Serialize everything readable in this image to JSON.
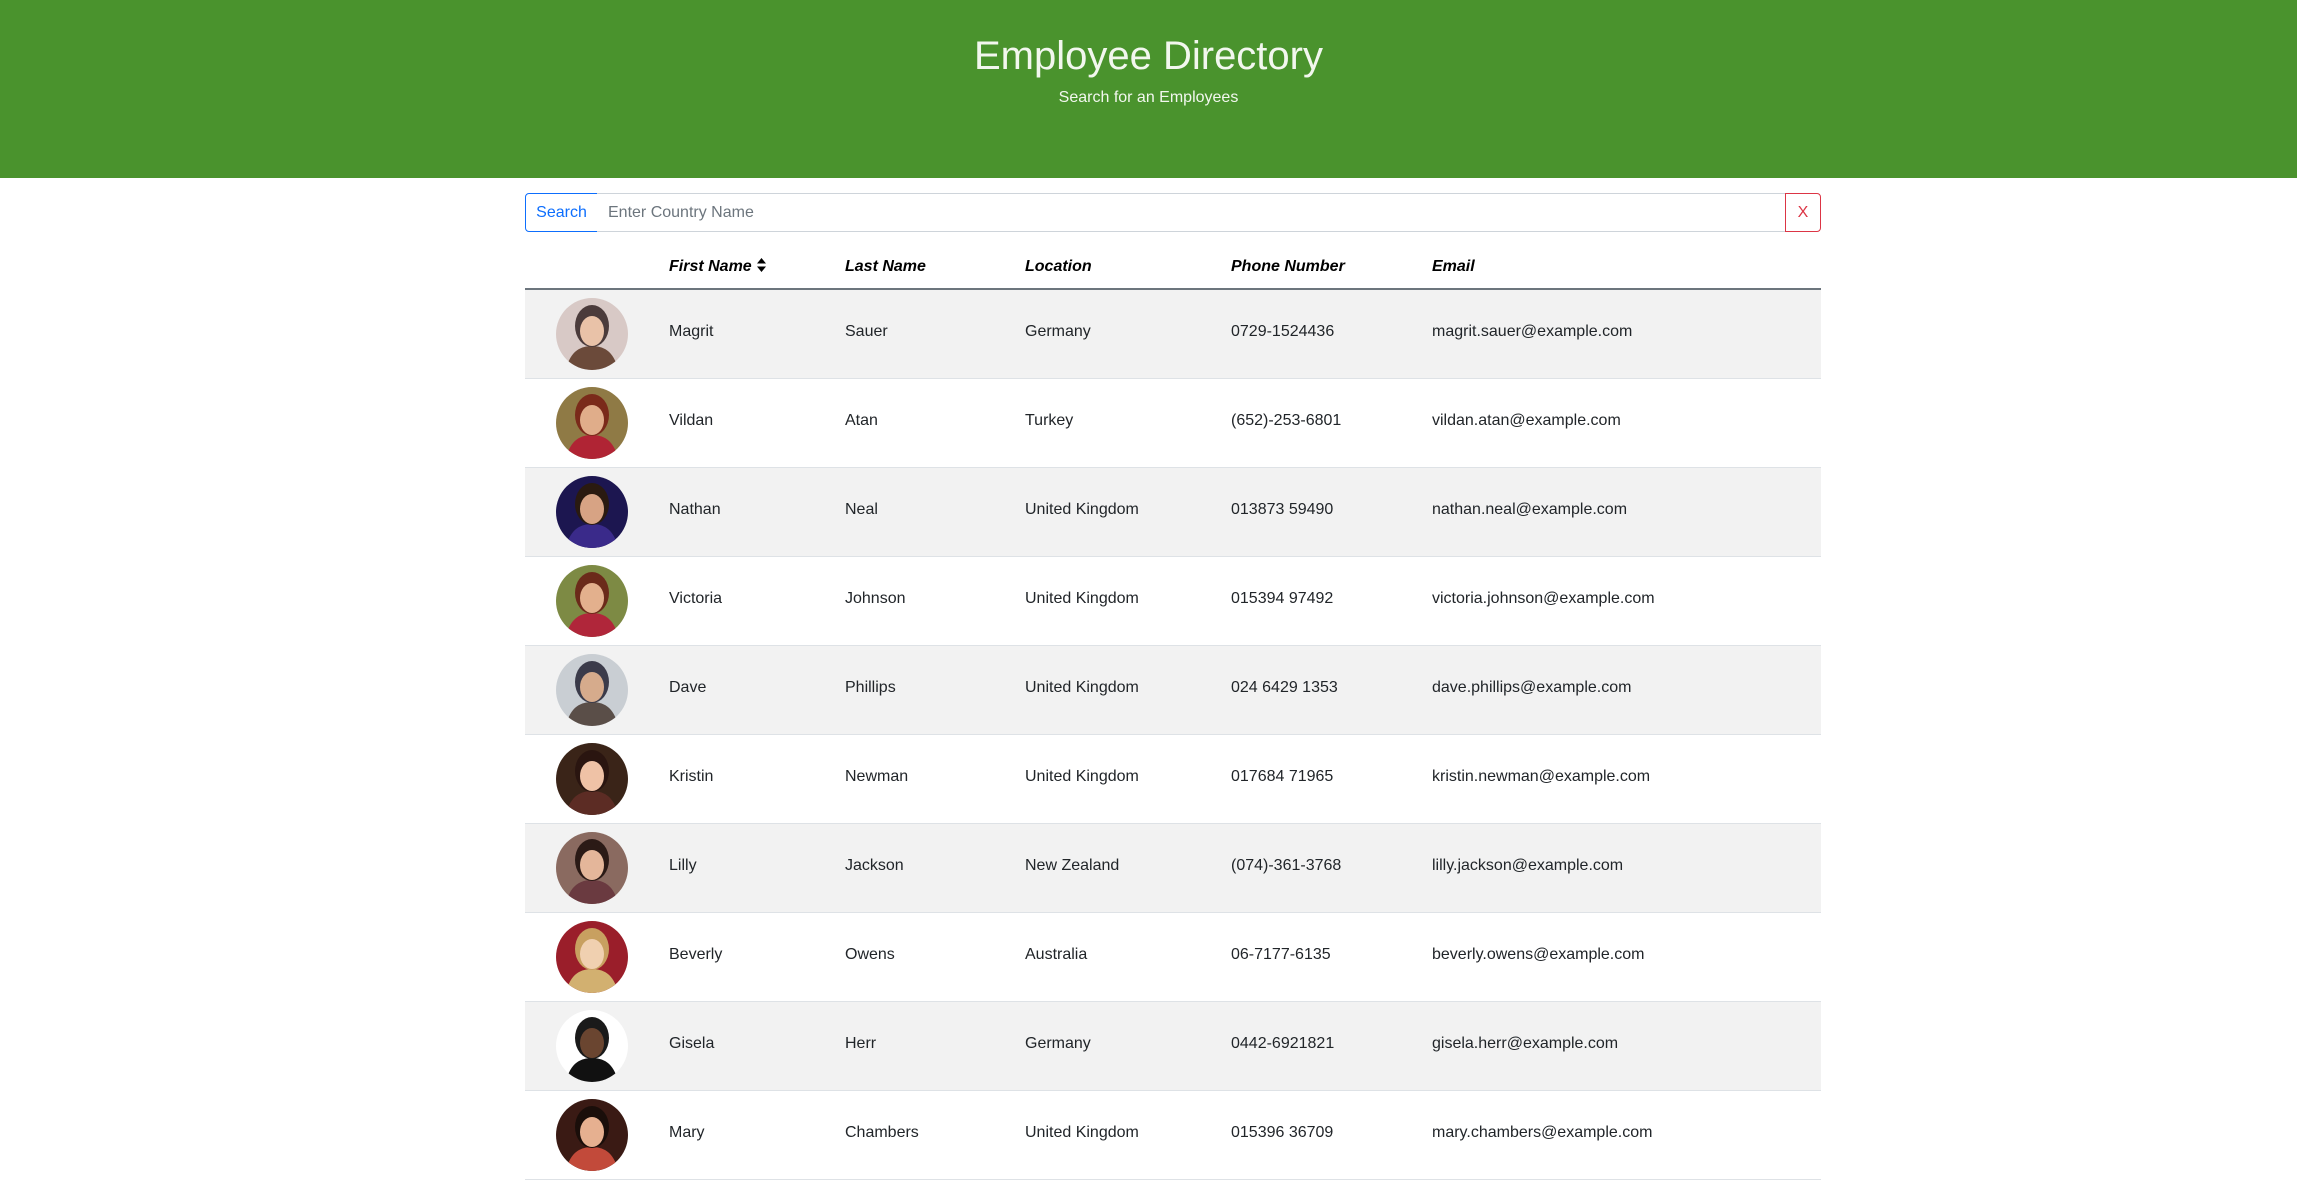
{
  "header": {
    "title": "Employee Directory",
    "subtitle": "Search for an Employees",
    "background_color": "#4a932d"
  },
  "search": {
    "button_label": "Search",
    "placeholder": "Enter Country Name",
    "value": "",
    "clear_label": "X"
  },
  "table": {
    "columns": {
      "image": "",
      "first_name": "First Name",
      "last_name": "Last Name",
      "location": "Location",
      "phone": "Phone Number",
      "email": "Email"
    },
    "sort_icon": "sort-icon",
    "rows": [
      {
        "first": "Magrit",
        "last": "Sauer",
        "location": "Germany",
        "phone": "0729-1524436",
        "email": "magrit.sauer@example.com"
      },
      {
        "first": "Vildan",
        "last": "Atan",
        "location": "Turkey",
        "phone": "(652)-253-6801",
        "email": "vildan.atan@example.com"
      },
      {
        "first": "Nathan",
        "last": "Neal",
        "location": "United Kingdom",
        "phone": "013873 59490",
        "email": "nathan.neal@example.com"
      },
      {
        "first": "Victoria",
        "last": "Johnson",
        "location": "United Kingdom",
        "phone": "015394 97492",
        "email": "victoria.johnson@example.com"
      },
      {
        "first": "Dave",
        "last": "Phillips",
        "location": "United Kingdom",
        "phone": "024 6429 1353",
        "email": "dave.phillips@example.com"
      },
      {
        "first": "Kristin",
        "last": "Newman",
        "location": "United Kingdom",
        "phone": "017684 71965",
        "email": "kristin.newman@example.com"
      },
      {
        "first": "Lilly",
        "last": "Jackson",
        "location": "New Zealand",
        "phone": "(074)-361-3768",
        "email": "lilly.jackson@example.com"
      },
      {
        "first": "Beverly",
        "last": "Owens",
        "location": "Australia",
        "phone": "06-7177-6135",
        "email": "beverly.owens@example.com"
      },
      {
        "first": "Gisela",
        "last": "Herr",
        "location": "Germany",
        "phone": "0442-6921821",
        "email": "gisela.herr@example.com"
      },
      {
        "first": "Mary",
        "last": "Chambers",
        "location": "United Kingdom",
        "phone": "015396 36709",
        "email": "mary.chambers@example.com"
      }
    ]
  }
}
